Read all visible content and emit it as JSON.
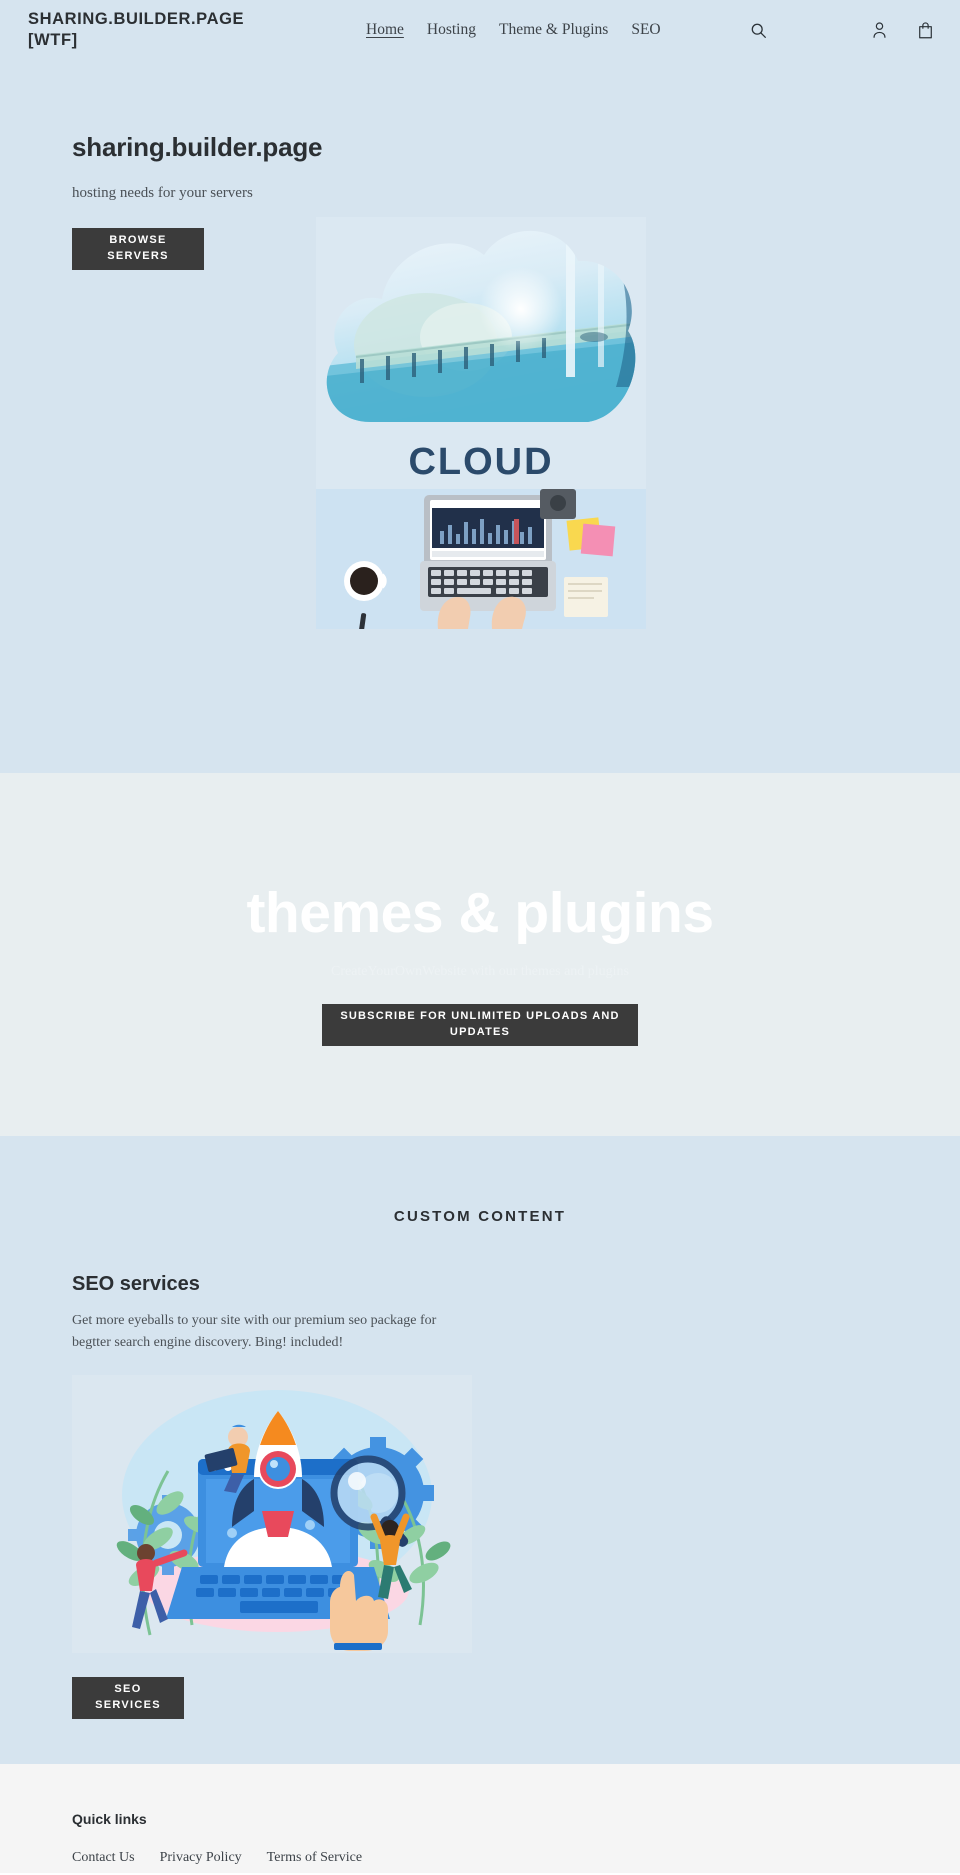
{
  "header": {
    "logo": "SHARING.BUILDER.PAGE [WTF]",
    "nav": [
      {
        "label": "Home",
        "active": true
      },
      {
        "label": "Hosting",
        "active": false
      },
      {
        "label": "Theme & Plugins",
        "active": false
      },
      {
        "label": "SEO",
        "active": false
      }
    ],
    "search_icon": "search-icon",
    "account_icon": "account-icon",
    "cart_icon": "shopping-bag-icon",
    "background": "#d6e4ef"
  },
  "hero": {
    "title": "sharing.builder.page",
    "subtitle": "hosting needs for your servers",
    "cta_line1": "BROWSE",
    "cta_line2": "SERVERS",
    "image_label": "CLOUD",
    "background": "#d6e4ef"
  },
  "themes": {
    "title": "themes & plugins",
    "subtitle": "CreateYourOwnWebsite with our themes and plugins",
    "cta_line1": "SUBSCRIBE FOR UNLIMITED UPLOADS AND",
    "cta_line2": "UPDATES",
    "background": "#e8eef0",
    "title_color": "#ffffff"
  },
  "custom": {
    "section_title": "CUSTOM CONTENT",
    "heading": "SEO services",
    "body": "Get more eyeballs to your site with our premium seo package for begtter search engine discovery. Bing! included!",
    "cta_line1": "SEO",
    "cta_line2": "SERVICES",
    "background": "#d6e4ef"
  },
  "footer": {
    "heading": "Quick links",
    "links": [
      "Contact Us",
      "Privacy Policy",
      "Terms of Service"
    ],
    "background": "#f5f5f5"
  },
  "theme": {
    "button_bg": "#3b3b3b",
    "button_text": "#ffffff",
    "text_dark": "#2b2f33",
    "text_muted": "#4b5157"
  }
}
